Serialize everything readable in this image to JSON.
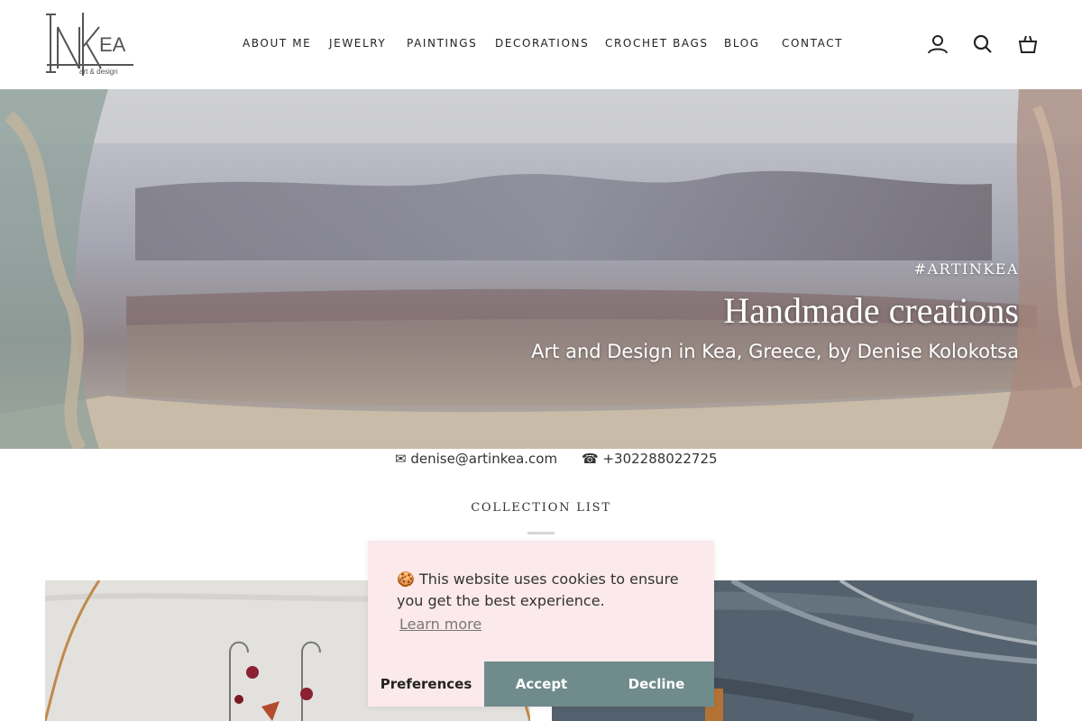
{
  "brand": {
    "logo_text": "INKEA",
    "logo_tagline": "art & design"
  },
  "nav": {
    "items": [
      "ABOUT ME",
      "JEWELRY",
      "PAINTINGS",
      "DECORATIONS",
      "CROCHET BAGS",
      "BLOG",
      "CONTACT"
    ]
  },
  "header_icons": [
    "user-icon",
    "search-icon",
    "cart-icon"
  ],
  "hero": {
    "tag": "#ARTINKEA",
    "title": "Handmade creations",
    "subtitle": "Art and Design in Kea, Greece, by Denise Kolokotsa"
  },
  "contact": {
    "email": "✉ denise@artinkea.com",
    "phone": "☎ +302288022725"
  },
  "collection": {
    "title": "COLLECTION LIST"
  },
  "cookie": {
    "message": "🍪 This website uses cookies to ensure you get the best experience.",
    "learn_more": "Learn more",
    "preferences": "Preferences",
    "accept": "Accept",
    "decline": "Decline"
  },
  "colors": {
    "cookie_bg": "#fbe9eb",
    "button_bg": "#708b8b",
    "text": "#222222"
  }
}
